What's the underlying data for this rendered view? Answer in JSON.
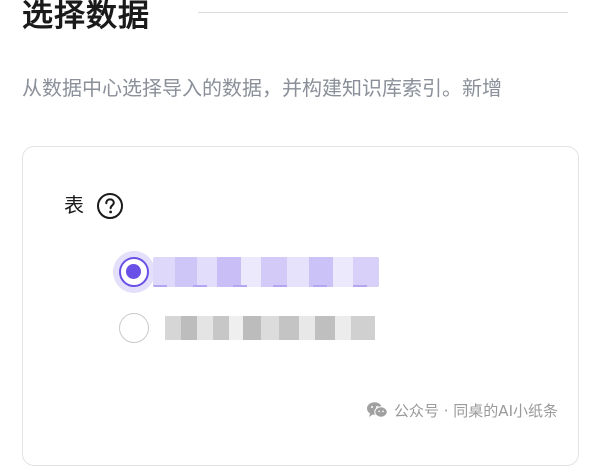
{
  "section": {
    "title": "选择数据",
    "description": "从数据中心选择导入的数据，并构建知识库索引。新增"
  },
  "table_field": {
    "label": "表",
    "help_icon": "question-circle-icon",
    "options": [
      {
        "selected": true
      },
      {
        "selected": false
      }
    ]
  },
  "watermark": {
    "icon": "wechat-icon",
    "text": "公众号 · 同桌的AI小纸条"
  },
  "colors": {
    "accent": "#6950e6",
    "muted_text": "#8a8f99",
    "border": "#e3e3e6"
  }
}
